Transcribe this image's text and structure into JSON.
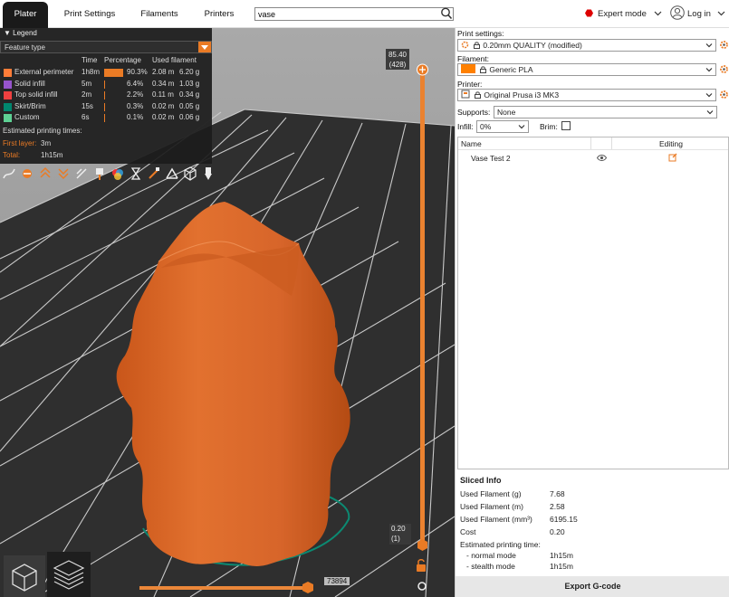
{
  "tabs": [
    {
      "label": "Plater",
      "active": true
    },
    {
      "label": "Print Settings",
      "active": false
    },
    {
      "label": "Filaments",
      "active": false
    },
    {
      "label": "Printers",
      "active": false
    }
  ],
  "search": {
    "value": "vase",
    "placeholder": ""
  },
  "mode": {
    "label": "Expert mode",
    "color": "#d40000"
  },
  "account": {
    "label": "Log in"
  },
  "legend": {
    "title": "Legend",
    "view_type": "Feature type",
    "columns": {
      "time": "Time",
      "percentage": "Percentage",
      "used_filament": "Used filament"
    },
    "rows": [
      {
        "name": "External perimeter",
        "color": "#ff7d38",
        "time": "1h8m",
        "percentage": "90.3%",
        "fraction": 0.903,
        "length": "2.08 m",
        "weight": "6.20 g"
      },
      {
        "name": "Solid infill",
        "color": "#9654cc",
        "time": "5m",
        "percentage": "6.4%",
        "fraction": 0.064,
        "length": "0.34 m",
        "weight": "1.03 g"
      },
      {
        "name": "Top solid infill",
        "color": "#f04040",
        "time": "2m",
        "percentage": "2.2%",
        "fraction": 0.022,
        "length": "0.11 m",
        "weight": "0.34 g"
      },
      {
        "name": "Skirt/Brim",
        "color": "#00876e",
        "time": "15s",
        "percentage": "0.3%",
        "fraction": 0.003,
        "length": "0.02 m",
        "weight": "0.05 g"
      },
      {
        "name": "Custom",
        "color": "#5ed194",
        "time": "6s",
        "percentage": "0.1%",
        "fraction": 0.001,
        "length": "0.02 m",
        "weight": "0.06 g"
      }
    ],
    "estimated_label": "Estimated printing times:",
    "first_layer_label": "First layer:",
    "first_layer_value": "3m",
    "total_label": "Total:",
    "total_value": "1h15m"
  },
  "layer_slider": {
    "top_value": "85.40",
    "top_index": "(428)",
    "bottom_value": "0.20",
    "bottom_index": "(1)"
  },
  "move_slider": {
    "value": "73894"
  },
  "print_settings": {
    "label": "Print settings:",
    "value": "0.20mm QUALITY (modified)"
  },
  "filament": {
    "label": "Filament:",
    "value": "Generic PLA",
    "color": "#ff8000"
  },
  "printer": {
    "label": "Printer:",
    "value": "Original Prusa i3 MK3"
  },
  "supports": {
    "label": "Supports:",
    "value": "None"
  },
  "infill": {
    "label": "Infill:",
    "value": "0%"
  },
  "brim": {
    "label": "Brim:",
    "checked": false
  },
  "object_list": {
    "col_name": "Name",
    "col_editing": "Editing",
    "items": [
      {
        "name": "Vase Test 2"
      }
    ]
  },
  "sliced_info": {
    "title": "Sliced Info",
    "rows": [
      {
        "label": "Used Filament (g)",
        "value": "7.68"
      },
      {
        "label": "Used Filament (m)",
        "value": "2.58"
      },
      {
        "label": "Used Filament (mm³)",
        "value": "6195.15"
      },
      {
        "label": "Cost",
        "value": "0.20"
      }
    ],
    "est_label": "Estimated printing time:",
    "normal_label": "- normal mode",
    "normal_value": "1h15m",
    "stealth_label": "- stealth mode",
    "stealth_value": "1h15m"
  },
  "export_button": {
    "label": "Export G-code"
  },
  "accent_color": "#ea7b25"
}
